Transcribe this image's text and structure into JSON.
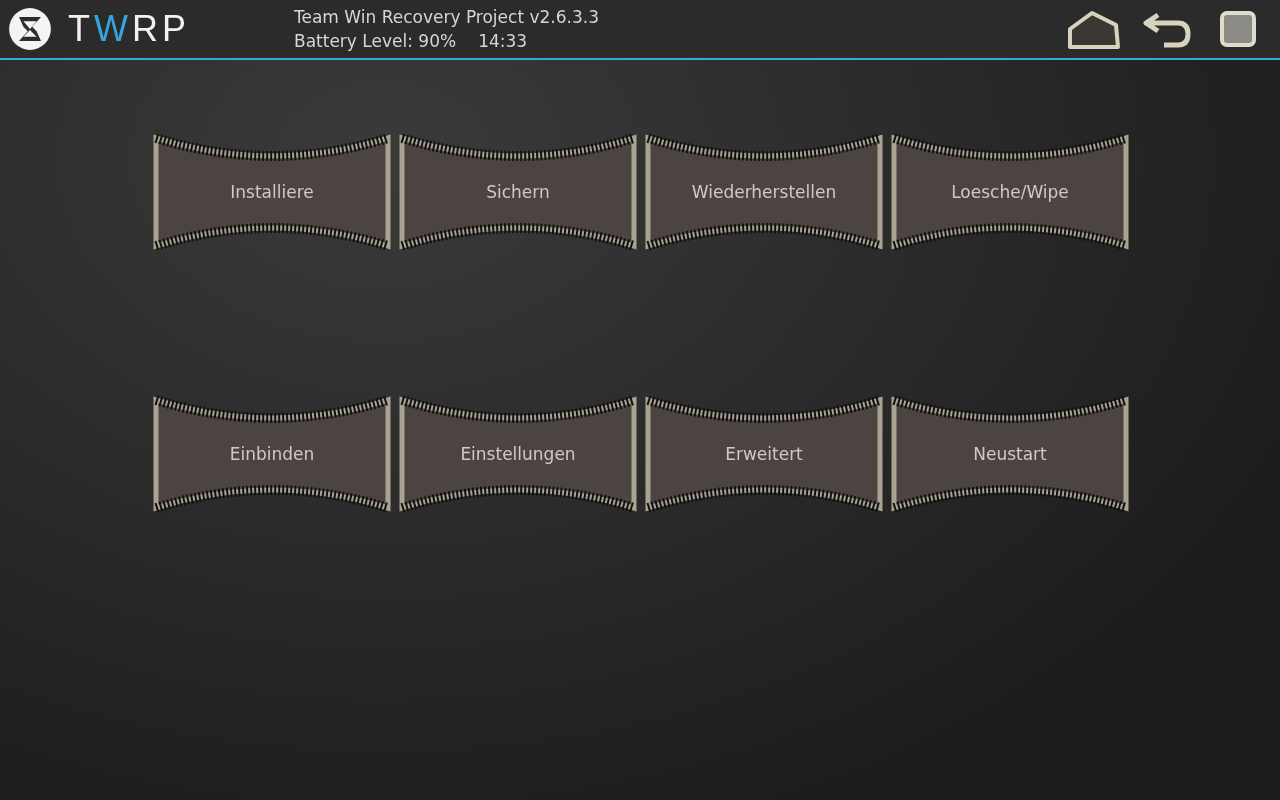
{
  "header": {
    "logo": [
      {
        "text": "T",
        "accent": false
      },
      {
        "text": "W",
        "accent": true
      },
      {
        "text": "RP",
        "accent": false
      }
    ],
    "title": "Team Win Recovery Project  v2.6.3.3",
    "battery": "Battery Level: 90%",
    "time": "14:33"
  },
  "menu": [
    {
      "label": "Installiere"
    },
    {
      "label": "Sichern"
    },
    {
      "label": "Wiederherstellen"
    },
    {
      "label": "Loesche/Wipe"
    },
    {
      "label": "Einbinden"
    },
    {
      "label": "Einstellungen"
    },
    {
      "label": "Erweitert"
    },
    {
      "label": "Neustart"
    }
  ]
}
